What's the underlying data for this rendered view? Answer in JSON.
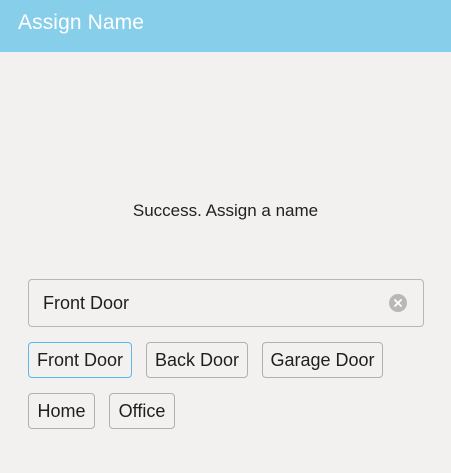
{
  "app_bar": {
    "title": "Assign Name",
    "color": "#87ceeb"
  },
  "status": {
    "message": "Success. Assign a name"
  },
  "name_field": {
    "value": "Front Door",
    "clear_icon": "clear-circle-icon"
  },
  "suggestions": {
    "selected_index": 0,
    "selected_color": "#5bb9e4",
    "items": [
      {
        "label": "Front Door"
      },
      {
        "label": "Back Door"
      },
      {
        "label": "Garage Door"
      },
      {
        "label": "Home"
      },
      {
        "label": "Office"
      }
    ]
  }
}
